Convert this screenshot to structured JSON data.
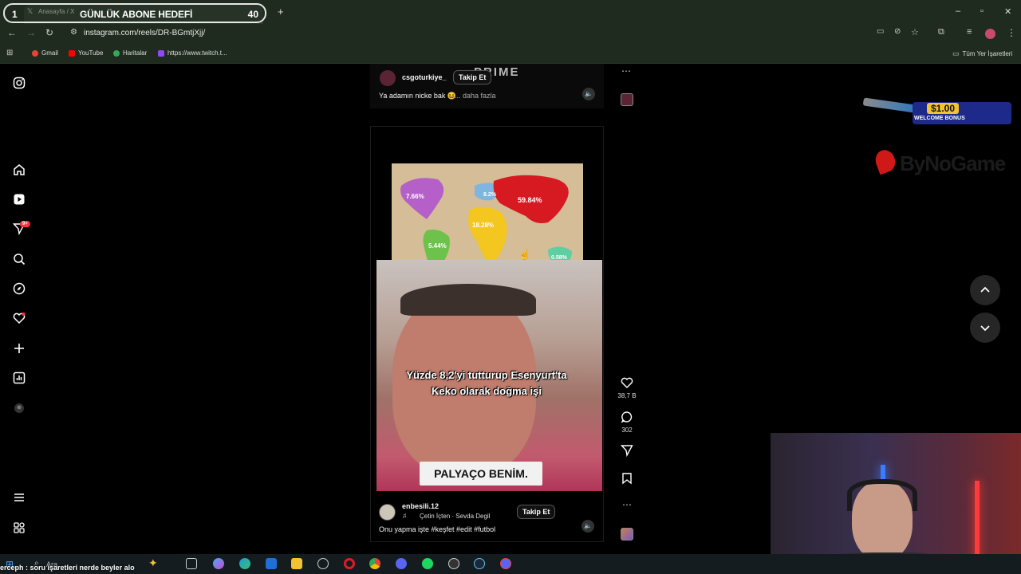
{
  "overlay": {
    "goal_left_num": "1",
    "goal_title": "GÜNLÜK ABONE HEDEFİ",
    "goal_right_num": "40"
  },
  "browser": {
    "tab_title": "Anasayfa / X",
    "url": "instagram.com/reels/DR-BGmtjXjj/",
    "bookmarks": [
      "Gmail",
      "YouTube",
      "Haritalar",
      "https://www.twitch.t..."
    ],
    "all_bookmarks": "Tüm Yer İşaretleri"
  },
  "sidebar": {
    "notification_badge": "9+"
  },
  "prev_reel": {
    "username": "csgoturkiye_",
    "follow": "Takip Et",
    "caption": "Ya adamın nicke bak 😆",
    "more": "... daha fazla",
    "overlay_text": "PRIME"
  },
  "reel": {
    "map_labels": [
      "7.66%",
      "8.2%",
      "59.84%",
      "18.28%",
      "5.44%",
      "0.58%"
    ],
    "caption_line1": "Yüzde 8,2'yi tutturup Esenyurt'ta",
    "caption_line2": "Keko olarak doğma işi",
    "sign": "PALYAÇO BENİM.",
    "username": "enbesili.12",
    "follow": "Takip Et",
    "music": "Çetin İçten · Sevda Degil",
    "description": "Onu yapma işte #keşfet #edit #futbol",
    "likes": "38,7 B",
    "comments": "302"
  },
  "ads": {
    "price": "$1.00",
    "bonus": "WELCOME BONUS",
    "brand": "ByNoGame"
  },
  "stream": {
    "chat_line": "erceph : soru işaretleri nerde beyler alo"
  },
  "taskbar": {
    "search": "Ara"
  },
  "colors": {
    "accent_follow_bg": "#111111",
    "badge": "#ff3040"
  }
}
